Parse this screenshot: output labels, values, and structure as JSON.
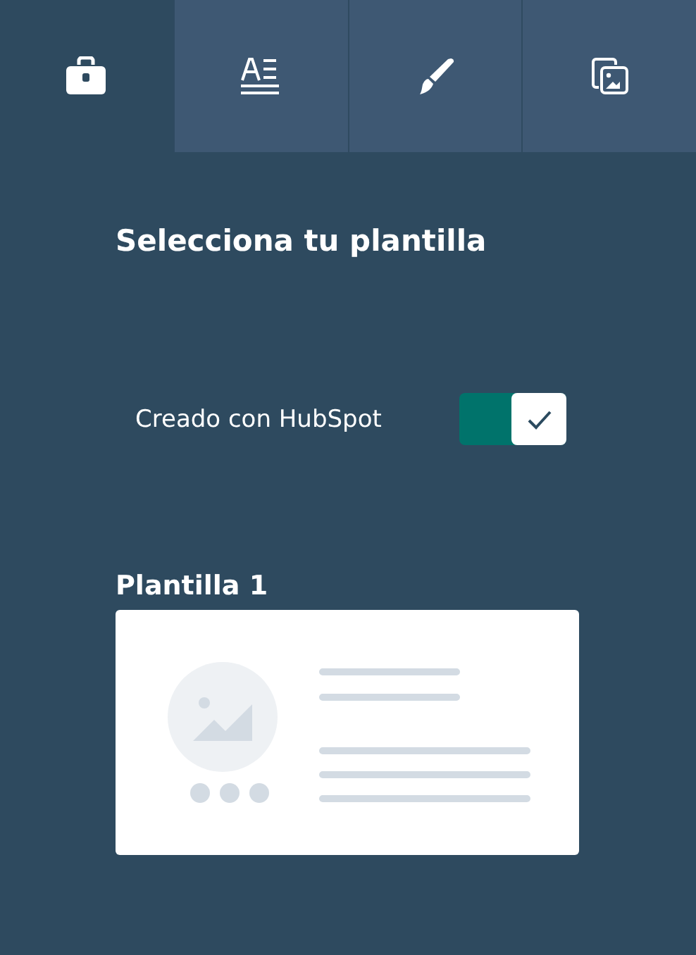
{
  "tabs": [
    {
      "kind": "toolbox",
      "selected": true
    },
    {
      "kind": "text",
      "selected": false
    },
    {
      "kind": "brush",
      "selected": false
    },
    {
      "kind": "images",
      "selected": false
    }
  ],
  "heading": "Selecciona tu plantilla",
  "toggle": {
    "label": "Creado con HubSpot",
    "on": true
  },
  "templates": [
    {
      "title": "Plantilla 1"
    }
  ]
}
